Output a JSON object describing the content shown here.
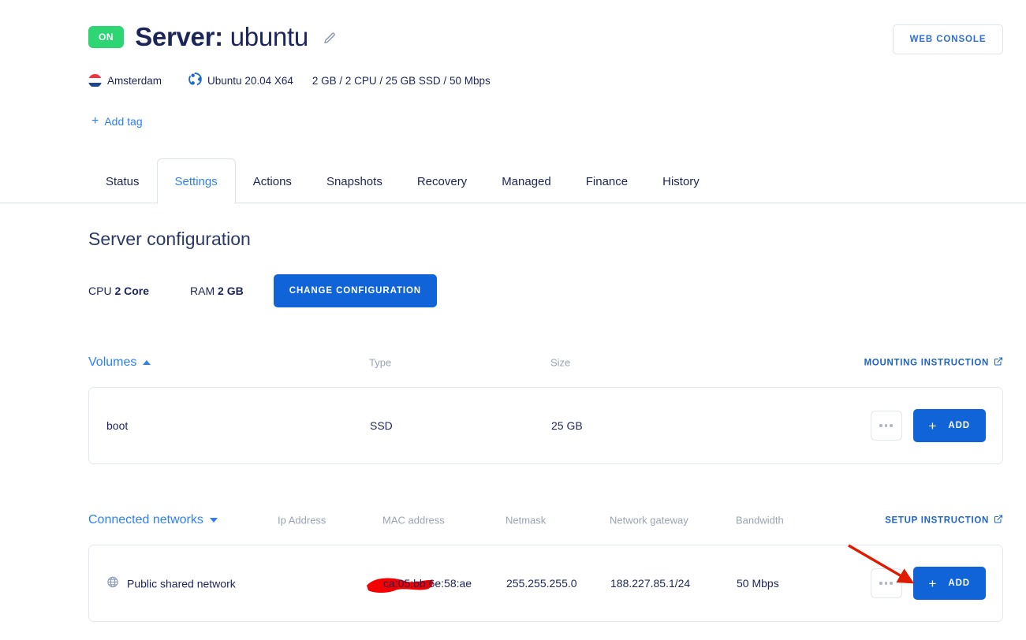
{
  "header": {
    "power_badge": "ON",
    "title_prefix": "Server:",
    "server_name": "ubuntu",
    "edit_icon": "pencil-icon",
    "web_console_label": "WEB CONSOLE",
    "meta": {
      "location_icon": "netherlands-flag-icon",
      "location": "Amsterdam",
      "os_icon": "ubuntu-logo-icon",
      "os": "Ubuntu 20.04 X64",
      "specs": "2 GB / 2 CPU / 25 GB SSD / 50 Mbps"
    },
    "add_tag_label": "Add tag"
  },
  "tabs": [
    {
      "label": "Status",
      "active": false
    },
    {
      "label": "Settings",
      "active": true
    },
    {
      "label": "Actions",
      "active": false
    },
    {
      "label": "Snapshots",
      "active": false
    },
    {
      "label": "Recovery",
      "active": false
    },
    {
      "label": "Managed",
      "active": false
    },
    {
      "label": "Finance",
      "active": false
    },
    {
      "label": "History",
      "active": false
    }
  ],
  "main": {
    "section_title": "Server configuration",
    "cpu_label": "CPU",
    "cpu_value": "2 Core",
    "ram_label": "RAM",
    "ram_value": "2 GB",
    "change_config_label": "CHANGE CONFIGURATION"
  },
  "volumes": {
    "title": "Volumes",
    "sort_icon": "caret-up-icon",
    "columns": [
      "Type",
      "Size"
    ],
    "instruction_label": "MOUNTING INSTRUCTION",
    "instruction_icon": "external-link-icon",
    "rows": [
      {
        "name": "boot",
        "type": "SSD",
        "size": "25 GB"
      }
    ],
    "more_icon": "ellipsis-icon",
    "add_label": "ADD",
    "add_icon": "plus-icon"
  },
  "networks": {
    "title": "Connected networks",
    "sort_icon": "caret-down-icon",
    "columns": [
      "Ip Address",
      "MAC address",
      "Netmask",
      "Network gateway",
      "Bandwidth"
    ],
    "instruction_label": "SETUP INSTRUCTION",
    "instruction_icon": "external-link-icon",
    "rows": [
      {
        "network_icon": "globe-icon",
        "name": "Public shared network",
        "ip_address": "",
        "ip_redacted": true,
        "mac_address": "ca:05:bb:6e:58:ae",
        "netmask": "255.255.255.0",
        "gateway": "188.227.85.1/24",
        "bandwidth": "50 Mbps"
      }
    ],
    "more_icon": "ellipsis-icon",
    "add_label": "ADD",
    "add_icon": "plus-icon"
  },
  "annotations": {
    "redaction_color": "#f50000",
    "arrow_color": "#e01b00",
    "arrow_target": "networks-add-button"
  },
  "colors": {
    "accent_blue": "#2d7ff9",
    "button_blue": "#1164d8",
    "link_blue": "#1e63c9",
    "on_green": "#2ed573",
    "text_dark": "#1b2559",
    "muted": "#9aa3b5",
    "border": "#e3e8f0"
  }
}
